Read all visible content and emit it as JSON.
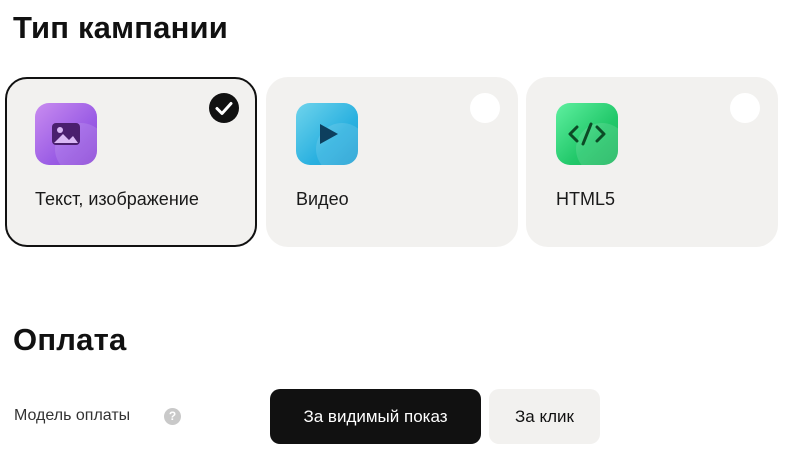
{
  "campaign_type": {
    "title": "Тип кампании",
    "options": [
      {
        "label": "Текст, изображение",
        "icon": "image-icon",
        "selected": true,
        "color": "#9b5de5"
      },
      {
        "label": "Видео",
        "icon": "play-icon",
        "selected": false,
        "color": "#2bb1e0"
      },
      {
        "label": "HTML5",
        "icon": "code-icon",
        "selected": false,
        "color": "#22c86a"
      }
    ]
  },
  "payment": {
    "title": "Оплата",
    "model_label": "Модель оплаты",
    "help_symbol": "?",
    "options": [
      {
        "label": "За видимый показ",
        "selected": true
      },
      {
        "label": "За клик",
        "selected": false
      }
    ]
  },
  "colors": {
    "selected_button_bg": "#111111",
    "card_bg": "#f2f1ef"
  }
}
